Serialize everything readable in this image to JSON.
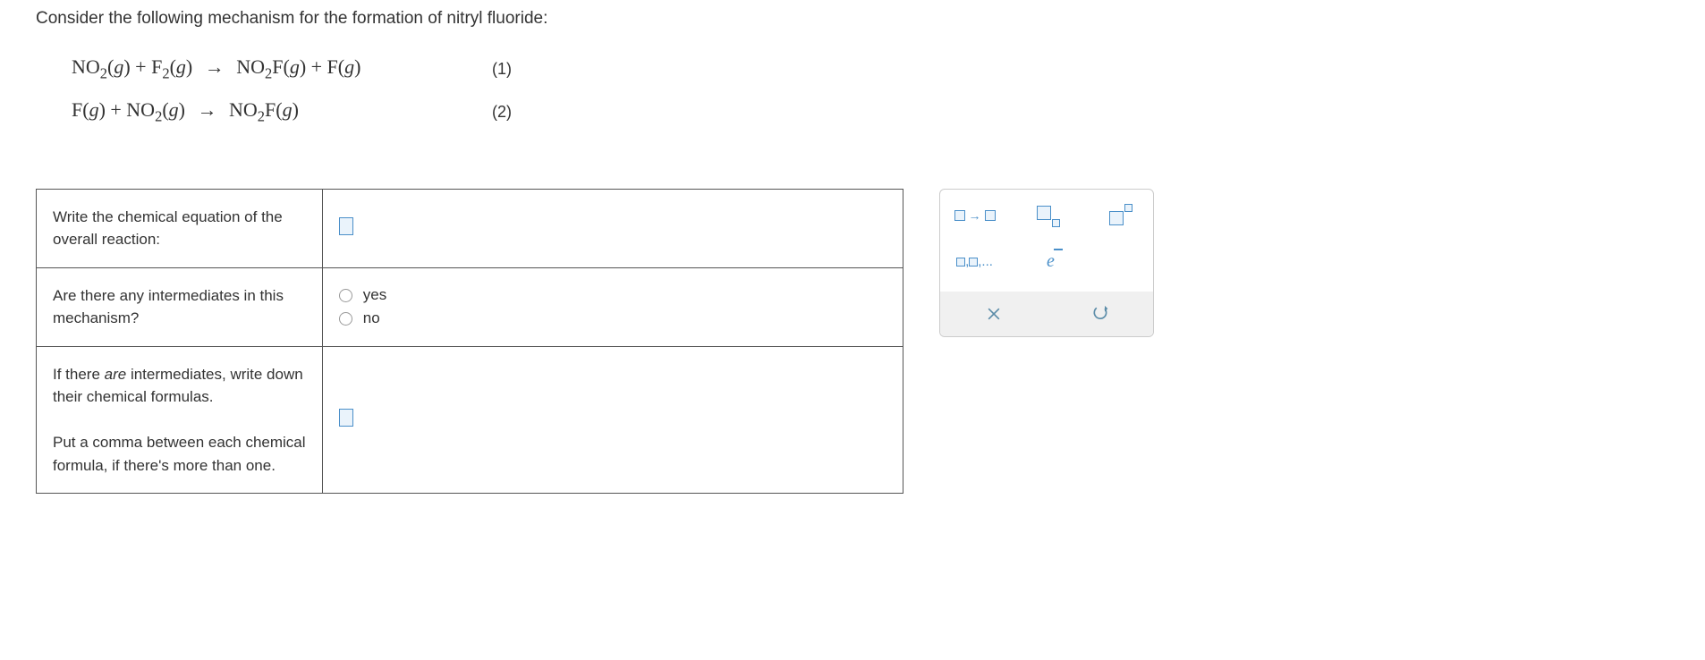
{
  "prompt": "Consider the following mechanism for the formation of nitryl fluoride:",
  "equations": [
    {
      "lhs_html": "NO<sub>2</sub>(<span class='italic'>g</span>) + F<sub>2</sub>(<span class='italic'>g</span>)",
      "rhs_html": "NO<sub>2</sub>F(<span class='italic'>g</span>) + F(<span class='italic'>g</span>)",
      "label": "(1)"
    },
    {
      "lhs_html": "F(<span class='italic'>g</span>) + NO<sub>2</sub>(<span class='italic'>g</span>)",
      "rhs_html": "NO<sub>2</sub>F(<span class='italic'>g</span>)",
      "label": "(2)"
    }
  ],
  "questions": {
    "q1_label": "Write the chemical equation of the overall reaction:",
    "q2_label": "Are there any intermediates in this mechanism?",
    "q3_label_part1": "If there ",
    "q3_label_em": "are",
    "q3_label_part2": " intermediates, write down their chemical formulas.",
    "q3_label_part3": "Put a comma between each chemical formula, if there's more than one.",
    "radio_yes": "yes",
    "radio_no": "no"
  }
}
